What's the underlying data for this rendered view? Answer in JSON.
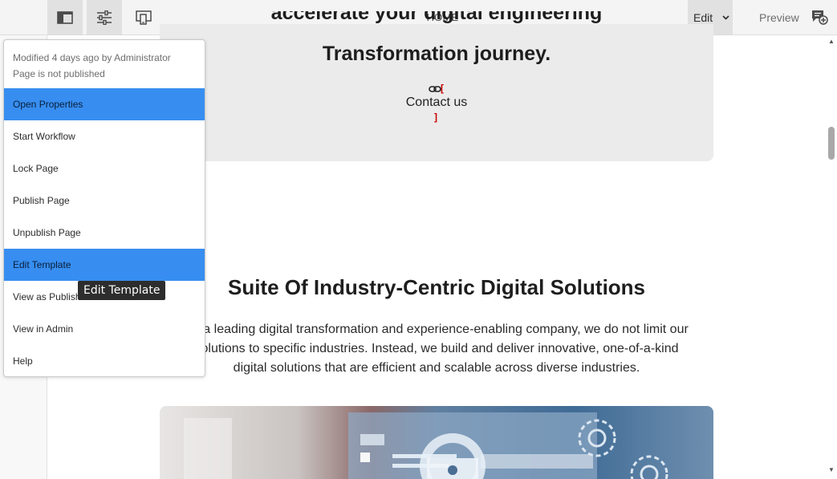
{
  "toolbar": {
    "title": "HOME",
    "edit_label": "Edit",
    "preview_label": "Preview",
    "icons": [
      "side-panel-icon",
      "properties-icon",
      "emulator-icon",
      "chevron-down-icon",
      "annotate-icon"
    ]
  },
  "page": {
    "hero_partial": "accelerate your digital engineering",
    "hero_line": "Transformation journey.",
    "contact_label": "Contact us",
    "bracket_open": "[",
    "bracket_close": "]",
    "section_title": "Suite Of Industry-Centric Digital Solutions",
    "section_text": "As a leading digital transformation and experience-enabling company, we do not limit our solutions to specific industries. Instead, we build and deliver innovative, one-of-a-kind digital solutions that are efficient and scalable across diverse industries."
  },
  "popover": {
    "modified": "Modified 4 days ago by Administrator",
    "status": "Page is not published",
    "items": [
      {
        "label": "Open Properties"
      },
      {
        "label": "Start Workflow"
      },
      {
        "label": "Lock Page"
      },
      {
        "label": "Publish Page"
      },
      {
        "label": "Unpublish Page"
      },
      {
        "label": "Edit Template"
      },
      {
        "label": "View as Published"
      },
      {
        "label": "View in Admin"
      },
      {
        "label": "Help"
      }
    ]
  },
  "tooltip": {
    "text": "Edit Template"
  },
  "colors": {
    "highlight": "#378ef0",
    "toolbar_bg": "#f4f4f4",
    "hero_bg": "#ebebeb",
    "tooltip_bg": "#2d2d2d"
  }
}
